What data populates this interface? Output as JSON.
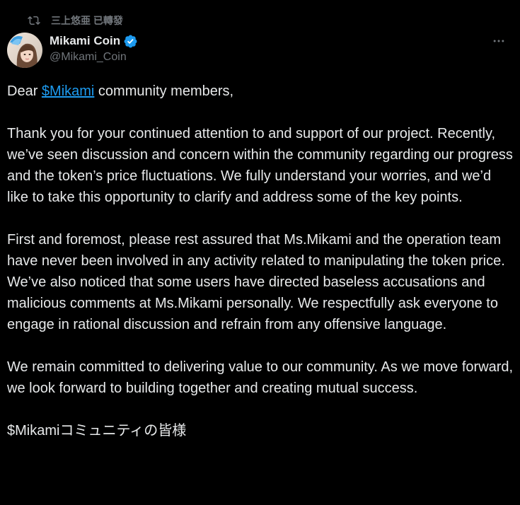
{
  "repost": {
    "icon": "repost-icon",
    "text": "三上悠亜 已轉發"
  },
  "author": {
    "avatar": "avatar",
    "display_name": "Mikami Coin",
    "verified_icon": "verified-badge-icon",
    "handle": "@Mikami_Coin"
  },
  "more_icon": "more-icon",
  "colors": {
    "background": "#000000",
    "text": "#e7e9ea",
    "muted": "#71767b",
    "link": "#1d9bf0"
  },
  "tweet": {
    "greeting_prefix": "Dear ",
    "cashtag": "$Mikami",
    "greeting_suffix": " community members,",
    "paragraph_1": "Thank you for your continued attention to and support of our project. Recently, we’ve seen discussion and concern within the community regarding our progress and the token’s price fluctuations. We fully understand your worries, and we’d like to take this opportunity to clarify and address some of the key points.",
    "paragraph_2": "First and foremost, please rest assured that Ms.Mikami and the operation team have never been involved in any activity related to manipulating the token price. We’ve also noticed that some users have directed baseless accusations and malicious comments at Ms.Mikami personally. We respectfully ask everyone to engage in rational discussion and refrain from any offensive language.",
    "paragraph_3": "We remain committed to delivering value to our community. As we move forward, we look forward to building together and creating mutual success.",
    "japanese_line": "$Mikamiコミュニティの皆様"
  }
}
